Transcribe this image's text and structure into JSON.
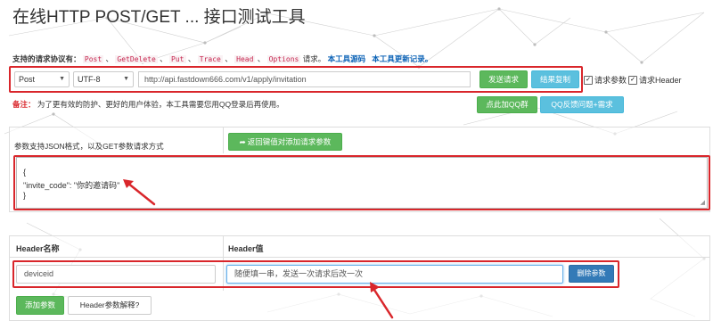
{
  "title": "在线HTTP POST/GET ... 接口测试工具",
  "protocols": {
    "label": "支持的请求协议有：",
    "methods": [
      "Post",
      "GetDelete",
      "Put",
      "Trace",
      "Head",
      "Options"
    ],
    "sep": "、",
    "suffix": "请求。",
    "link_source": "本工具源码",
    "link_changelog": "本工具更新记录。"
  },
  "request": {
    "method": "Post",
    "encoding": "UTF-8",
    "url": "http://api.fastdown666.com/v1/apply/invitation",
    "send_label": "发送请求",
    "copy_label": "结果复制",
    "check_params_label": "请求参数",
    "check_header_label": "请求Header",
    "check_params_checked": true,
    "check_header_checked": true
  },
  "notice": {
    "label": "备注：",
    "text": "为了更有效的防护、更好的用户体验，本工具需要您用QQ登录后再使用。",
    "qq_group_label": "点此加QQ群",
    "qq_feedback_label": "QQ反馈问题+需求"
  },
  "params": {
    "hint": "参数支持JSON格式，以及GET参数请求方式",
    "return_btn_label": "返回键值对添加请求参数",
    "json_lines": [
      "{",
      "\"invite_code\": \"你的邀请码\"",
      "}"
    ]
  },
  "header": {
    "col_name": "Header名称",
    "col_value": "Header值",
    "name_value": "deviceid",
    "value_value": "随便填一串，发送一次请求后改一次",
    "delete_label": "删除参数",
    "add_label": "添加参数",
    "explain_label": "Header参数解释?"
  },
  "colors": {
    "highlight_red": "#d9262b",
    "btn_green": "#5cb85c",
    "btn_blue": "#5bc0de",
    "btn_darkblue": "#337ab7",
    "link_blue": "#0b62b6",
    "method_code": "#c7254e"
  }
}
